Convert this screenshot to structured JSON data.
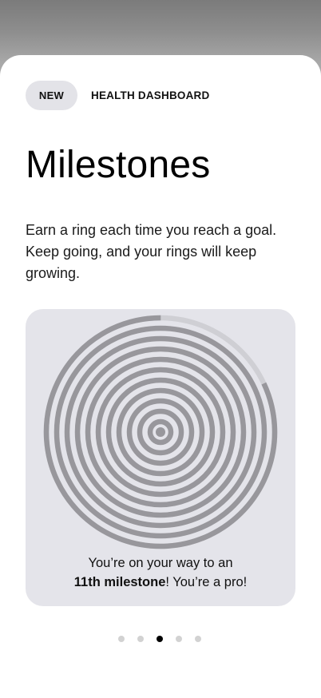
{
  "badge": {
    "label": "NEW"
  },
  "header": {
    "label": "HEALTH DASHBOARD"
  },
  "title": "Milestones",
  "description": "Earn a ring each time you reach a goal. Keep going, and your rings will keep growing.",
  "card": {
    "caption_line1": "You’re on your way to an",
    "caption_bold": "11th milestone",
    "caption_rest": "! You’re a pro!",
    "rings": {
      "completed": 10,
      "in_progress_fraction": 0.18,
      "ring_color": "#98979c",
      "track_color": "#cfcfd4"
    }
  },
  "pagination": {
    "count": 5,
    "active_index": 2
  },
  "colors": {
    "sheet_background": "#ffffff",
    "card_background": "#e4e4ea",
    "badge_background": "#e3e3e8",
    "active_dot": "#000000",
    "inactive_dot": "#d2d2d2"
  }
}
